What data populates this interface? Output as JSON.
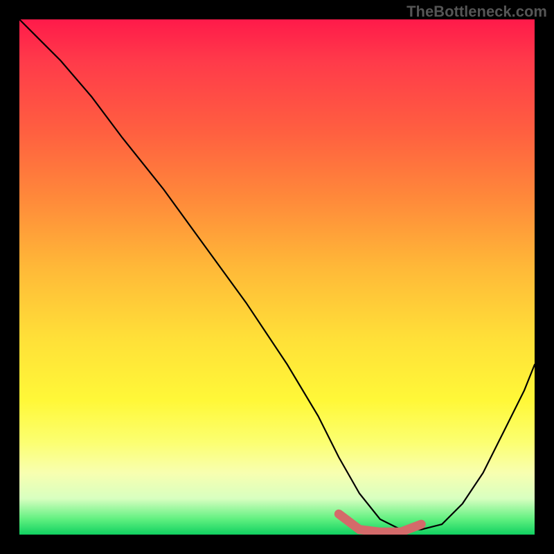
{
  "watermark": "TheBottleneck.com",
  "chart_data": {
    "type": "line",
    "title": "",
    "xlabel": "",
    "ylabel": "",
    "xlim": [
      0,
      100
    ],
    "ylim": [
      0,
      100
    ],
    "series": [
      {
        "name": "bottleneck-curve",
        "x": [
          0,
          4,
          8,
          14,
          20,
          28,
          36,
          44,
          52,
          58,
          62,
          66,
          70,
          74,
          78,
          82,
          86,
          90,
          94,
          98,
          100
        ],
        "values": [
          100,
          96,
          92,
          85,
          77,
          67,
          56,
          45,
          33,
          23,
          15,
          8,
          3,
          1,
          1,
          2,
          6,
          12,
          20,
          28,
          33
        ]
      },
      {
        "name": "highlight-band",
        "x": [
          62,
          66,
          70,
          74,
          78
        ],
        "values": [
          4,
          1,
          0.5,
          0.5,
          2
        ]
      }
    ],
    "gradient_stops": [
      {
        "pos": 0,
        "color": "#ff1a4a"
      },
      {
        "pos": 22,
        "color": "#ff6040"
      },
      {
        "pos": 48,
        "color": "#ffb838"
      },
      {
        "pos": 74,
        "color": "#fff838"
      },
      {
        "pos": 93,
        "color": "#d8ffc0"
      },
      {
        "pos": 100,
        "color": "#10d060"
      }
    ]
  }
}
